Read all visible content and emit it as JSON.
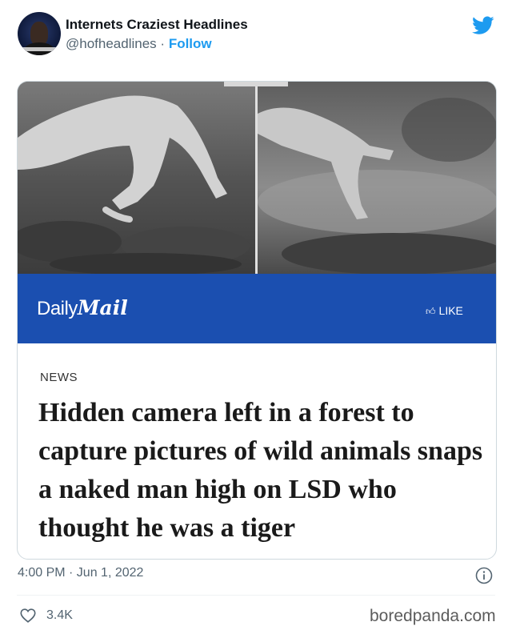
{
  "tweet": {
    "author_name": "Internets Craziest Headlines",
    "handle": "@hofheadlines",
    "separator": "·",
    "follow_label": "Follow",
    "timestamp": "4:00 PM · Jun 1, 2022",
    "like_count": "3.4K"
  },
  "article_card": {
    "brand_part1": "Daily",
    "brand_part2": "Mail",
    "like_label": "LIKE",
    "section": "NEWS",
    "headline": "Hidden camera left in a forest to capture pictures of wild animals snaps a naked man high on LSD who thought he was a tiger"
  },
  "watermark": "boredpanda.com",
  "colors": {
    "accent": "#1d9bf0",
    "banner": "#1b4fb0",
    "muted_text": "#536471"
  },
  "icons": {
    "brand": "twitter-bird-icon",
    "info": "info-icon",
    "like": "heart-icon",
    "banner_like": "thumbs-up-icon"
  }
}
